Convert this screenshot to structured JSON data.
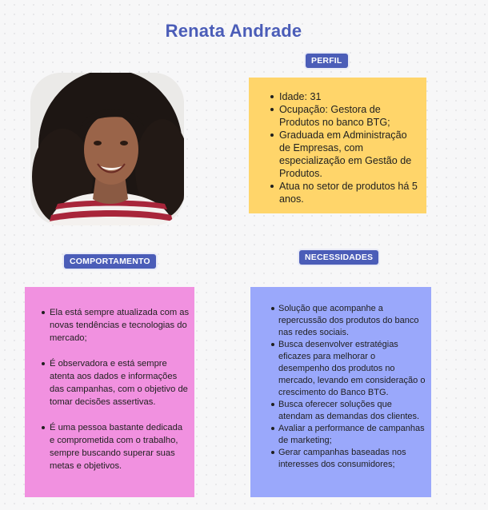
{
  "title": "Renata Andrade",
  "sections": {
    "profile": {
      "label": "PERFIL",
      "items": [
        "Idade: 31",
        "Ocupação: Gestora de Produtos no banco BTG;",
        "Graduada em Administração de Empresas, com especialização em Gestão de Produtos.",
        "Atua no setor de produtos há 5 anos."
      ]
    },
    "behavior": {
      "label": "COMPORTAMENTO",
      "items": [
        "Ela está sempre atualizada com as novas tendências e tecnologias do mercado;",
        "É observadora e está sempre atenta aos dados e informações das campanhas, com o objetivo de tomar decisões assertivas.",
        "É uma pessoa bastante dedicada e comprometida com o trabalho, sempre buscando superar suas metas e objetivos."
      ]
    },
    "needs": {
      "label": "NECESSIDADES",
      "items": [
        "Solução que acompanhe a repercussão dos produtos do banco nas redes sociais.",
        "Busca desenvolver estratégias eficazes para melhorar o desempenho dos produtos no mercado, levando em consideração o crescimento do Banco BTG.",
        "Busca oferecer soluções que atendam as demandas dos clientes.",
        "Avaliar a performance de campanhas de marketing;",
        "Gerar campanhas baseadas nos interesses dos consumidores;"
      ]
    }
  },
  "colors": {
    "accent": "#4b5db8",
    "profile_card": "#ffd56a",
    "behavior_card": "#f191e0",
    "needs_card": "#9aa8fb"
  },
  "photo": {
    "icon": "person-portrait"
  }
}
